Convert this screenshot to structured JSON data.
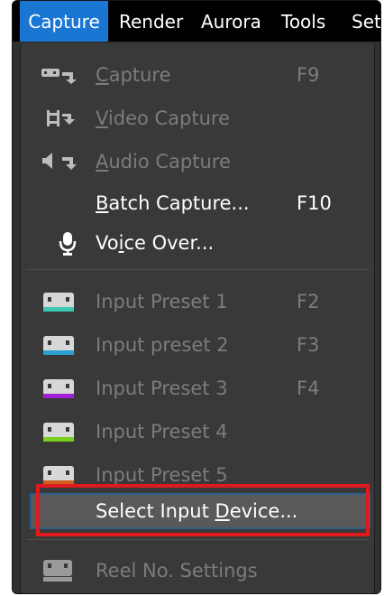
{
  "menubar": {
    "items": [
      {
        "label": "Capture",
        "active": true
      },
      {
        "label": "Render"
      },
      {
        "label": "Aurora"
      },
      {
        "label": "Tools"
      },
      {
        "label": "Set"
      }
    ]
  },
  "menu": {
    "capture": {
      "pre": "",
      "ul": "C",
      "post": "apture",
      "shortcut": "F9",
      "icon": "capture-icon",
      "enabled": false
    },
    "video_capture": {
      "pre": "",
      "ul": "V",
      "post": "ideo Capture",
      "icon": "video-capture-icon",
      "enabled": false
    },
    "audio_capture": {
      "pre": "",
      "ul": "A",
      "post": "udio Capture",
      "icon": "audio-capture-icon",
      "enabled": false
    },
    "batch_capture": {
      "pre": "",
      "ul": "B",
      "post": "atch Capture...",
      "shortcut": "F10",
      "enabled": true
    },
    "voice_over": {
      "pre": "Vo",
      "ul": "i",
      "post": "ce Over...",
      "icon": "microphone-icon",
      "enabled": true
    },
    "presets": [
      {
        "label": "Input Preset 1",
        "shortcut": "F2",
        "color": "#3ec8b4",
        "icon": "input-preset-icon"
      },
      {
        "label": "Input preset 2",
        "shortcut": "F3",
        "color": "#2aa0d0",
        "icon": "input-preset-icon"
      },
      {
        "label": "Input Preset 3",
        "shortcut": "F4",
        "color": "#a020d8",
        "icon": "input-preset-icon"
      },
      {
        "label": "Input Preset 4",
        "shortcut": "",
        "color": "#7cd020",
        "icon": "input-preset-icon"
      },
      {
        "label": "Input Preset 5",
        "shortcut": "",
        "color": "#d06020",
        "icon": "input-preset-icon"
      }
    ],
    "select_input_device": {
      "pre": "Select Input ",
      "ul": "D",
      "post": "evice...",
      "enabled": true,
      "highlighted": true
    },
    "reel_settings": {
      "label": "Reel No. Settings",
      "icon": "reel-settings-icon",
      "enabled": false
    }
  },
  "colors": {
    "menubar_active": "#1976d2",
    "highlight_box": "#e0191f",
    "menu_bg": "#393939"
  }
}
